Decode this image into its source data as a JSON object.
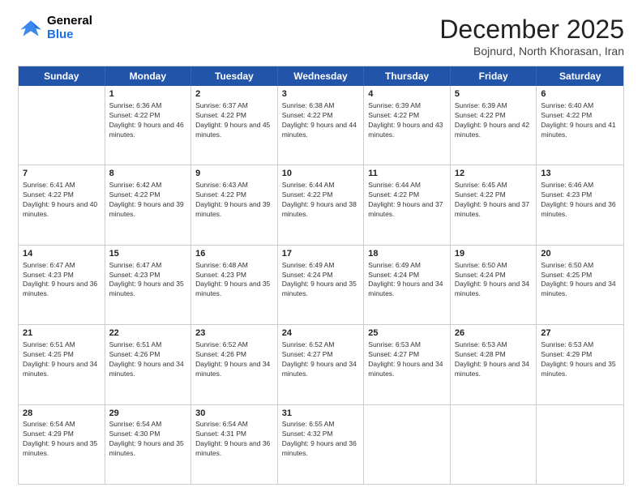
{
  "header": {
    "logo_line1": "General",
    "logo_line2": "Blue",
    "month": "December 2025",
    "location": "Bojnurd, North Khorasan, Iran"
  },
  "weekdays": [
    "Sunday",
    "Monday",
    "Tuesday",
    "Wednesday",
    "Thursday",
    "Friday",
    "Saturday"
  ],
  "rows": [
    [
      {
        "day": "",
        "sunrise": "",
        "sunset": "",
        "daylight": ""
      },
      {
        "day": "1",
        "sunrise": "Sunrise: 6:36 AM",
        "sunset": "Sunset: 4:22 PM",
        "daylight": "Daylight: 9 hours and 46 minutes."
      },
      {
        "day": "2",
        "sunrise": "Sunrise: 6:37 AM",
        "sunset": "Sunset: 4:22 PM",
        "daylight": "Daylight: 9 hours and 45 minutes."
      },
      {
        "day": "3",
        "sunrise": "Sunrise: 6:38 AM",
        "sunset": "Sunset: 4:22 PM",
        "daylight": "Daylight: 9 hours and 44 minutes."
      },
      {
        "day": "4",
        "sunrise": "Sunrise: 6:39 AM",
        "sunset": "Sunset: 4:22 PM",
        "daylight": "Daylight: 9 hours and 43 minutes."
      },
      {
        "day": "5",
        "sunrise": "Sunrise: 6:39 AM",
        "sunset": "Sunset: 4:22 PM",
        "daylight": "Daylight: 9 hours and 42 minutes."
      },
      {
        "day": "6",
        "sunrise": "Sunrise: 6:40 AM",
        "sunset": "Sunset: 4:22 PM",
        "daylight": "Daylight: 9 hours and 41 minutes."
      }
    ],
    [
      {
        "day": "7",
        "sunrise": "Sunrise: 6:41 AM",
        "sunset": "Sunset: 4:22 PM",
        "daylight": "Daylight: 9 hours and 40 minutes."
      },
      {
        "day": "8",
        "sunrise": "Sunrise: 6:42 AM",
        "sunset": "Sunset: 4:22 PM",
        "daylight": "Daylight: 9 hours and 39 minutes."
      },
      {
        "day": "9",
        "sunrise": "Sunrise: 6:43 AM",
        "sunset": "Sunset: 4:22 PM",
        "daylight": "Daylight: 9 hours and 39 minutes."
      },
      {
        "day": "10",
        "sunrise": "Sunrise: 6:44 AM",
        "sunset": "Sunset: 4:22 PM",
        "daylight": "Daylight: 9 hours and 38 minutes."
      },
      {
        "day": "11",
        "sunrise": "Sunrise: 6:44 AM",
        "sunset": "Sunset: 4:22 PM",
        "daylight": "Daylight: 9 hours and 37 minutes."
      },
      {
        "day": "12",
        "sunrise": "Sunrise: 6:45 AM",
        "sunset": "Sunset: 4:22 PM",
        "daylight": "Daylight: 9 hours and 37 minutes."
      },
      {
        "day": "13",
        "sunrise": "Sunrise: 6:46 AM",
        "sunset": "Sunset: 4:23 PM",
        "daylight": "Daylight: 9 hours and 36 minutes."
      }
    ],
    [
      {
        "day": "14",
        "sunrise": "Sunrise: 6:47 AM",
        "sunset": "Sunset: 4:23 PM",
        "daylight": "Daylight: 9 hours and 36 minutes."
      },
      {
        "day": "15",
        "sunrise": "Sunrise: 6:47 AM",
        "sunset": "Sunset: 4:23 PM",
        "daylight": "Daylight: 9 hours and 35 minutes."
      },
      {
        "day": "16",
        "sunrise": "Sunrise: 6:48 AM",
        "sunset": "Sunset: 4:23 PM",
        "daylight": "Daylight: 9 hours and 35 minutes."
      },
      {
        "day": "17",
        "sunrise": "Sunrise: 6:49 AM",
        "sunset": "Sunset: 4:24 PM",
        "daylight": "Daylight: 9 hours and 35 minutes."
      },
      {
        "day": "18",
        "sunrise": "Sunrise: 6:49 AM",
        "sunset": "Sunset: 4:24 PM",
        "daylight": "Daylight: 9 hours and 34 minutes."
      },
      {
        "day": "19",
        "sunrise": "Sunrise: 6:50 AM",
        "sunset": "Sunset: 4:24 PM",
        "daylight": "Daylight: 9 hours and 34 minutes."
      },
      {
        "day": "20",
        "sunrise": "Sunrise: 6:50 AM",
        "sunset": "Sunset: 4:25 PM",
        "daylight": "Daylight: 9 hours and 34 minutes."
      }
    ],
    [
      {
        "day": "21",
        "sunrise": "Sunrise: 6:51 AM",
        "sunset": "Sunset: 4:25 PM",
        "daylight": "Daylight: 9 hours and 34 minutes."
      },
      {
        "day": "22",
        "sunrise": "Sunrise: 6:51 AM",
        "sunset": "Sunset: 4:26 PM",
        "daylight": "Daylight: 9 hours and 34 minutes."
      },
      {
        "day": "23",
        "sunrise": "Sunrise: 6:52 AM",
        "sunset": "Sunset: 4:26 PM",
        "daylight": "Daylight: 9 hours and 34 minutes."
      },
      {
        "day": "24",
        "sunrise": "Sunrise: 6:52 AM",
        "sunset": "Sunset: 4:27 PM",
        "daylight": "Daylight: 9 hours and 34 minutes."
      },
      {
        "day": "25",
        "sunrise": "Sunrise: 6:53 AM",
        "sunset": "Sunset: 4:27 PM",
        "daylight": "Daylight: 9 hours and 34 minutes."
      },
      {
        "day": "26",
        "sunrise": "Sunrise: 6:53 AM",
        "sunset": "Sunset: 4:28 PM",
        "daylight": "Daylight: 9 hours and 34 minutes."
      },
      {
        "day": "27",
        "sunrise": "Sunrise: 6:53 AM",
        "sunset": "Sunset: 4:29 PM",
        "daylight": "Daylight: 9 hours and 35 minutes."
      }
    ],
    [
      {
        "day": "28",
        "sunrise": "Sunrise: 6:54 AM",
        "sunset": "Sunset: 4:29 PM",
        "daylight": "Daylight: 9 hours and 35 minutes."
      },
      {
        "day": "29",
        "sunrise": "Sunrise: 6:54 AM",
        "sunset": "Sunset: 4:30 PM",
        "daylight": "Daylight: 9 hours and 35 minutes."
      },
      {
        "day": "30",
        "sunrise": "Sunrise: 6:54 AM",
        "sunset": "Sunset: 4:31 PM",
        "daylight": "Daylight: 9 hours and 36 minutes."
      },
      {
        "day": "31",
        "sunrise": "Sunrise: 6:55 AM",
        "sunset": "Sunset: 4:32 PM",
        "daylight": "Daylight: 9 hours and 36 minutes."
      },
      {
        "day": "",
        "sunrise": "",
        "sunset": "",
        "daylight": ""
      },
      {
        "day": "",
        "sunrise": "",
        "sunset": "",
        "daylight": ""
      },
      {
        "day": "",
        "sunrise": "",
        "sunset": "",
        "daylight": ""
      }
    ]
  ]
}
